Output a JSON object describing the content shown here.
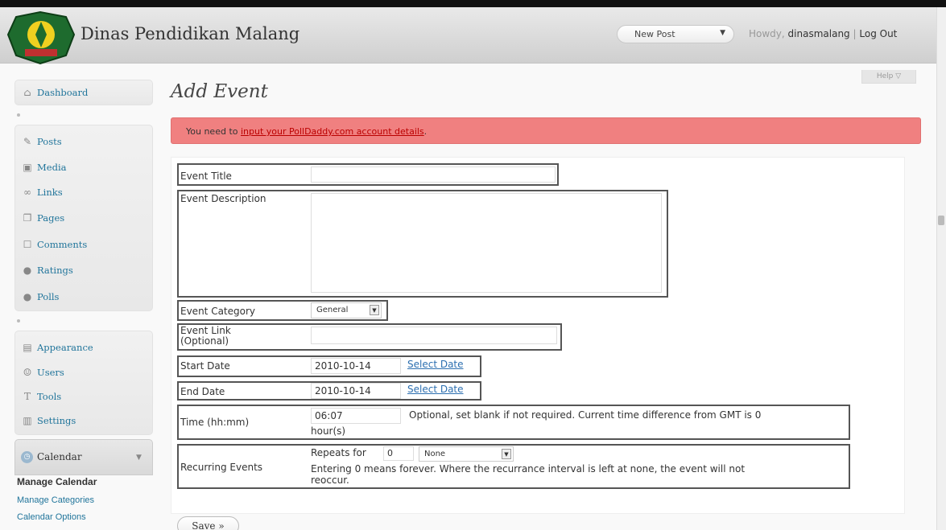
{
  "header": {
    "site_title": "Dinas Pendidikan Malang",
    "favorite_action": "New Post",
    "howdy": "Howdy,",
    "username": "dinasmalang",
    "separator": "|",
    "logout": "Log Out",
    "help": "Help ▽"
  },
  "sidebar": {
    "dashboard": "Dashboard",
    "items": [
      {
        "label": "Posts",
        "icon": "pin-icon"
      },
      {
        "label": "Media",
        "icon": "media-icon"
      },
      {
        "label": "Links",
        "icon": "links-icon"
      },
      {
        "label": "Pages",
        "icon": "pages-icon"
      },
      {
        "label": "Comments",
        "icon": "comments-icon"
      },
      {
        "label": "Ratings",
        "icon": "ratings-icon"
      },
      {
        "label": "Polls",
        "icon": "polls-icon"
      }
    ],
    "items2": [
      {
        "label": "Appearance",
        "icon": "appearance-icon"
      },
      {
        "label": "Users",
        "icon": "users-icon"
      },
      {
        "label": "Tools",
        "icon": "tools-icon"
      },
      {
        "label": "Settings",
        "icon": "settings-icon"
      }
    ],
    "calendar": {
      "label": "Calendar",
      "submenu": [
        "Manage Calendar",
        "Manage Categories",
        "Calendar Options"
      ]
    }
  },
  "main": {
    "page_title": "Add Event",
    "notice_prefix": "You need to ",
    "notice_link": "input your PollDaddy.com account details",
    "notice_suffix": "."
  },
  "form": {
    "event_title_label": "Event Title",
    "event_title_value": "",
    "event_description_label": "Event Description",
    "event_category_label": "Event Category",
    "event_category_value": "General",
    "event_link_label": "Event Link (Optional)",
    "start_date_label": "Start Date",
    "start_date_value": "2010-10-14",
    "end_date_label": "End Date",
    "end_date_value": "2010-10-14",
    "select_date": "Select Date",
    "time_label": "Time (hh:mm)",
    "time_value": "06:07",
    "time_note": "Optional, set blank if not required. Current time difference from GMT is 0",
    "time_note2": "hour(s)",
    "recurring_label": "Recurring Events",
    "repeats_for": "Repeats for",
    "repeats_value": "0",
    "repeats_interval": "None",
    "recurring_note": "Entering 0 means forever. Where the recurrance interval is left at none, the event will not",
    "recurring_note2": "reoccur.",
    "save": "Save »"
  },
  "colors": {
    "notice_bg": "#f08080",
    "link": "#21759b",
    "header_bg": "#d9d9d9"
  }
}
